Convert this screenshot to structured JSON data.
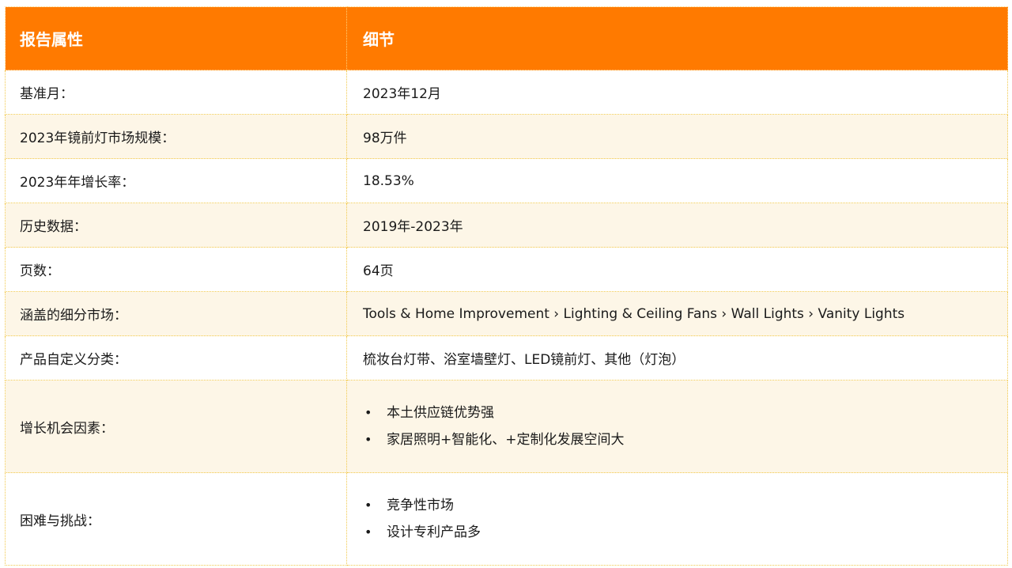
{
  "header": {
    "col1": "报告属性",
    "col2": "细节"
  },
  "rows": [
    {
      "label": "基准月：",
      "value": "2023年12月"
    },
    {
      "label": "2023年镜前灯市场规模：",
      "value": "98万件"
    },
    {
      "label": "2023年年增长率：",
      "value": "18.53%"
    },
    {
      "label": "历史数据：",
      "value": "2019年-2023年"
    },
    {
      "label": "页数：",
      "value": "64页"
    },
    {
      "label": "涵盖的细分市场：",
      "value": "Tools & Home Improvement › Lighting & Ceiling Fans › Wall Lights › Vanity Lights"
    },
    {
      "label": "产品自定义分类：",
      "value": "梳妆台灯带、浴室墙壁灯、LED镜前灯、其他（灯泡）"
    },
    {
      "label": "增长机会因素：",
      "bullets": [
        "本土供应链优势强",
        "家居照明+智能化、+定制化发展空间大"
      ]
    },
    {
      "label": "困难与挑战：",
      "bullets": [
        "竞争性市场",
        "设计专利产品多"
      ]
    }
  ],
  "bullet_char": "•",
  "colors": {
    "header_bg": "#ff7a00",
    "header_text": "#ffffff",
    "row_tint": "#fdf6e7",
    "border": "#f2c94c"
  }
}
